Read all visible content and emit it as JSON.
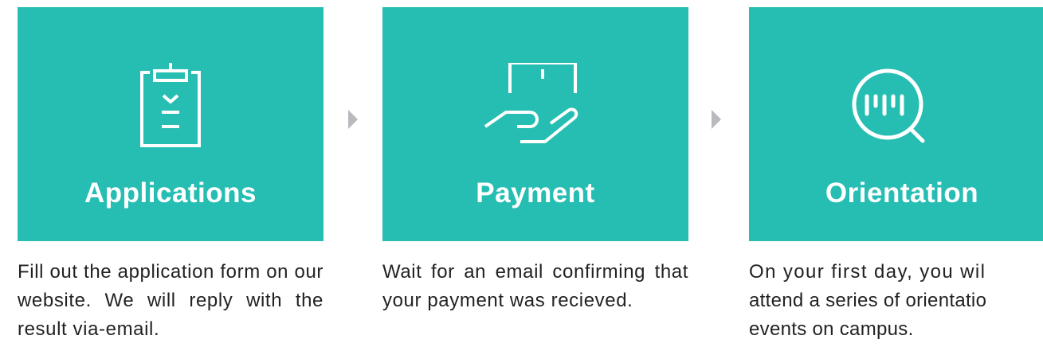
{
  "steps": [
    {
      "title": "Applications",
      "icon": "clipboard-check-icon",
      "description": "Fill out the application form on our website. We will reply with the result via-email."
    },
    {
      "title": "Payment",
      "icon": "hand-holding-box-icon",
      "description": "Wait for an email confirming that your payment was recieved."
    },
    {
      "title": "Orientation",
      "icon": "magnifier-chart-icon",
      "description_lines": [
        "On your first day, you wil",
        "attend a series of orientatio",
        "events on campus."
      ]
    }
  ],
  "colors": {
    "card": "#26beb3",
    "text": "#222222",
    "arrow": "#b8babd"
  }
}
